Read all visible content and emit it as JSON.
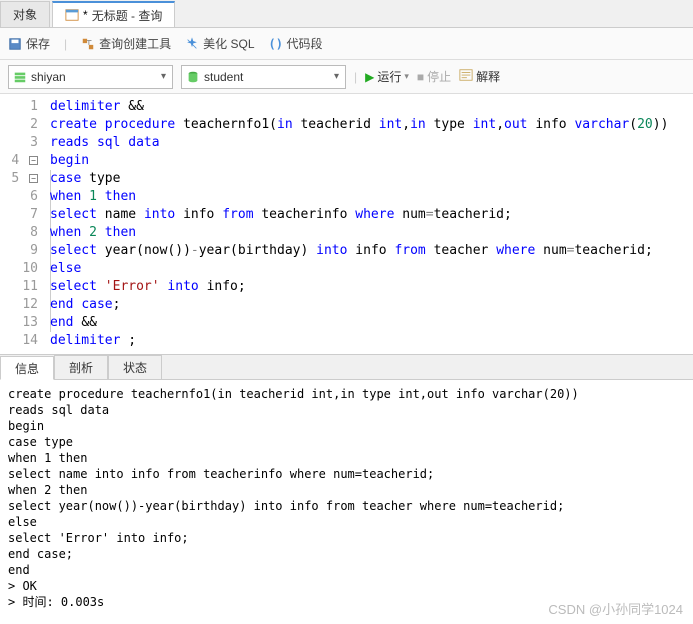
{
  "tabs": {
    "object": "对象",
    "query_prefix": "*",
    "query_label": "无标题 - 查询"
  },
  "toolbar": {
    "save": "保存",
    "query_builder": "查询创建工具",
    "beautify": "美化 SQL",
    "snippet": "代码段"
  },
  "selector": {
    "connection": "shiyan",
    "database": "student",
    "run": "运行",
    "stop": "停止",
    "explain": "解释"
  },
  "code_lines": [
    {
      "n": "1",
      "fold": "",
      "html": "<span class='kw-blue'>delimiter</span> <span class='punct'>&amp;&amp;</span>"
    },
    {
      "n": "2",
      "fold": "",
      "html": "<span class='kw-blue'>create</span> <span class='kw-blue'>procedure</span> <span class='ident'>teachernfo1</span><span class='punct'>(</span><span class='kw-blue'>in</span> <span class='ident'>teacherid</span> <span class='kw-blue'>int</span><span class='punct'>,</span><span class='kw-blue'>in</span> <span class='ident'>type</span> <span class='kw-blue'>int</span><span class='punct'>,</span><span class='kw-blue'>out</span> <span class='ident'>info</span> <span class='kw-blue'>varchar</span><span class='punct'>(</span><span class='num'>20</span><span class='punct'>))</span>"
    },
    {
      "n": "3",
      "fold": "",
      "html": "<span class='kw-blue'>reads</span> <span class='kw-blue'>sql</span> <span class='kw-blue'>data</span>"
    },
    {
      "n": "4",
      "fold": "-",
      "html": "<span class='kw-blue'>begin</span>"
    },
    {
      "n": "5",
      "fold": "-",
      "html": "<span class='kw-blue'>case</span> <span class='ident'>type</span>"
    },
    {
      "n": "6",
      "fold": "",
      "html": "<span class='kw-blue'>when</span> <span class='num'>1</span> <span class='kw-blue'>then</span>"
    },
    {
      "n": "7",
      "fold": "",
      "html": "<span class='kw-blue'>select</span> <span class='ident'>name</span> <span class='kw-blue'>into</span> <span class='ident'>info</span> <span class='kw-blue'>from</span> <span class='ident'>teacherinfo</span> <span class='kw-blue'>where</span> <span class='ident'>num</span><span class='kw-gray'>=</span><span class='ident'>teacherid</span><span class='punct'>;</span>"
    },
    {
      "n": "8",
      "fold": "",
      "html": "<span class='kw-blue'>when</span> <span class='num'>2</span> <span class='kw-blue'>then</span>"
    },
    {
      "n": "9",
      "fold": "",
      "html": "<span class='kw-blue'>select</span> <span class='ident'>year</span><span class='punct'>(</span><span class='ident'>now</span><span class='punct'>())</span><span class='kw-gray'>-</span><span class='ident'>year</span><span class='punct'>(</span><span class='ident'>birthday</span><span class='punct'>)</span> <span class='kw-blue'>into</span> <span class='ident'>info</span> <span class='kw-blue'>from</span> <span class='ident'>teacher</span> <span class='kw-blue'>where</span> <span class='ident'>num</span><span class='kw-gray'>=</span><span class='ident'>teacherid</span><span class='punct'>;</span>"
    },
    {
      "n": "10",
      "fold": "",
      "html": "<span class='kw-blue'>else</span>"
    },
    {
      "n": "11",
      "fold": "",
      "html": "<span class='kw-blue'>select</span> <span class='str'>'Error'</span> <span class='kw-blue'>into</span> <span class='ident'>info</span><span class='punct'>;</span>"
    },
    {
      "n": "12",
      "fold": "",
      "html": "<span class='kw-blue'>end</span> <span class='kw-blue'>case</span><span class='punct'>;</span>"
    },
    {
      "n": "13",
      "fold": "",
      "html": "<span class='kw-blue'>end</span> <span class='punct'>&amp;&amp;</span>"
    },
    {
      "n": "14",
      "fold": "",
      "html": "<span class='kw-blue'>delimiter</span> <span class='punct'>;</span>"
    }
  ],
  "result_tabs": {
    "info": "信息",
    "profile": "剖析",
    "status": "状态"
  },
  "result_text": "create procedure teachernfo1(in teacherid int,in type int,out info varchar(20))\nreads sql data\nbegin\ncase type\nwhen 1 then\nselect name into info from teacherinfo where num=teacherid;\nwhen 2 then\nselect year(now())-year(birthday) into info from teacher where num=teacherid;\nelse\nselect 'Error' into info;\nend case;\nend\n> OK\n> 时间: 0.003s",
  "watermark": "CSDN @小孙同学1024"
}
